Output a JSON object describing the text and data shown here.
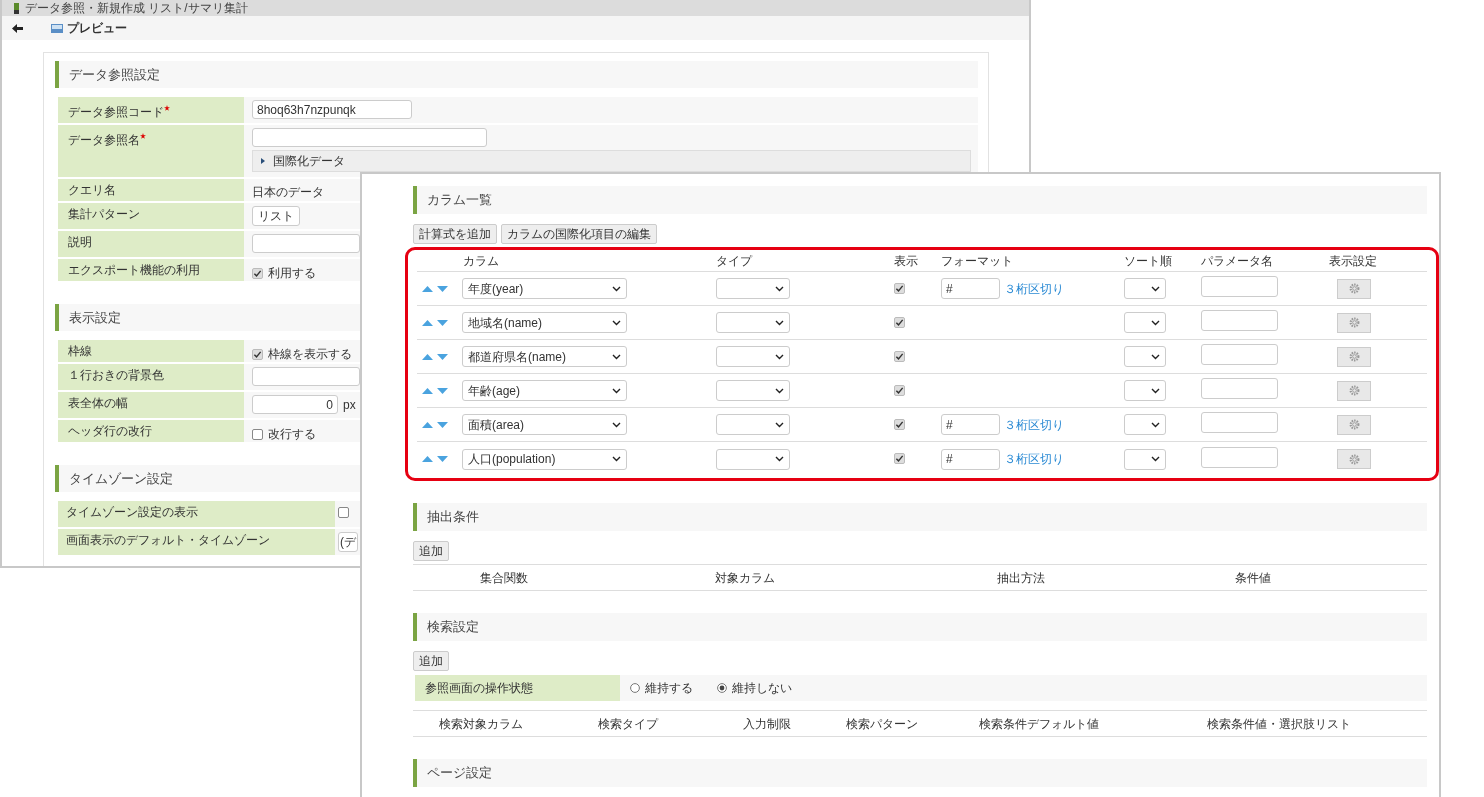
{
  "back_window": {
    "title": "データ参照・新規作成 リスト/サマリ集計",
    "toolbar": {
      "preview": "プレビュー"
    },
    "sections": [
      {
        "title": "データ参照設定",
        "rows": [
          {
            "kind": "input",
            "label": "データ参照コード",
            "required": true,
            "value": "8hoq63h7nzpunqk"
          },
          {
            "kind": "input_i18n",
            "label": "データ参照名",
            "required": true,
            "expander": "国際化データ"
          },
          {
            "kind": "text",
            "label": "クエリ名",
            "value": "日本のデータ"
          },
          {
            "kind": "select",
            "label": "集計パターン",
            "value": "リスト"
          },
          {
            "kind": "input",
            "label": "説明"
          },
          {
            "kind": "checkbox",
            "label": "エクスポート機能の利用",
            "checked": true,
            "text": "利用する"
          }
        ]
      },
      {
        "title": "表示設定",
        "rows": [
          {
            "kind": "checkbox",
            "label": "枠線",
            "checked": true,
            "text": "枠線を表示する"
          },
          {
            "kind": "input",
            "label": "１行おきの背景色"
          },
          {
            "kind": "number",
            "label": "表全体の幅",
            "value": "0",
            "unit": "px"
          },
          {
            "kind": "checkbox",
            "label": "ヘッダ行の改行",
            "checked": false,
            "text": "改行する"
          }
        ]
      },
      {
        "title": "タイムゾーン設定",
        "wide": true,
        "rows": [
          {
            "kind": "checkbox",
            "label": "タイムゾーン設定の表示",
            "checked": false
          },
          {
            "kind": "select",
            "label": "画面表示のデフォルト・タイムゾーン",
            "value": "(デ"
          }
        ]
      }
    ]
  },
  "front_window": {
    "sections": [
      {
        "kind": "columns",
        "title": "カラム一覧",
        "buttons": [
          "計算式を追加",
          "カラムの国際化項目の編集"
        ],
        "highlighted": true,
        "columns": [
          "カラム",
          "タイプ",
          "表示",
          "フォーマット",
          "ソート順",
          "パラメータ名",
          "表示設定"
        ],
        "rows": [
          {
            "column": "年度(year)",
            "visible": true,
            "format": "#",
            "format_link": "３桁区切り"
          },
          {
            "column": "地域名(name)",
            "visible": true
          },
          {
            "column": "都道府県名(name)",
            "visible": true
          },
          {
            "column": "年齢(age)",
            "visible": true
          },
          {
            "column": "面積(area)",
            "visible": true,
            "format": "#",
            "format_link": "３桁区切り"
          },
          {
            "column": "人口(population)",
            "visible": true,
            "format": "#",
            "format_link": "３桁区切り"
          }
        ]
      },
      {
        "kind": "conditions",
        "title": "抽出条件",
        "buttons": [
          "追加"
        ],
        "columns": [
          "集合関数",
          "対象カラム",
          "抽出方法",
          "条件値"
        ]
      },
      {
        "kind": "search",
        "title": "検索設定",
        "buttons": [
          "追加"
        ],
        "setting": {
          "label": "参照画面の操作状態",
          "options": [
            {
              "label": "維持する",
              "selected": false
            },
            {
              "label": "維持しない",
              "selected": true
            }
          ]
        },
        "columns": [
          "検索対象カラム",
          "検索タイプ",
          "入力制限",
          "検索パターン",
          "検索条件デフォルト値",
          "検索条件値・選択肢リスト"
        ]
      },
      {
        "kind": "plain",
        "title": "ページ設定"
      }
    ]
  }
}
